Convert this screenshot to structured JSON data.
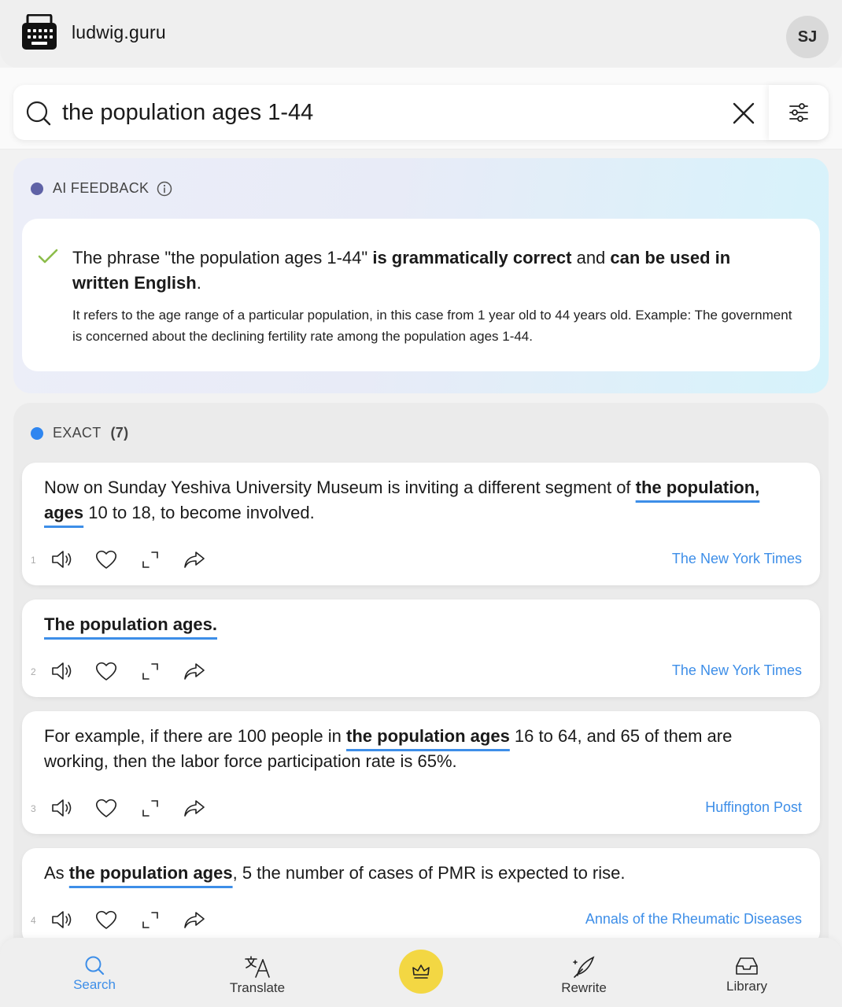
{
  "header": {
    "brand": "ludwig.guru",
    "avatar_initials": "SJ",
    "logo_icon": "typewriter-icon"
  },
  "search": {
    "query": "the population ages 1-44",
    "placeholder": ""
  },
  "ai_feedback": {
    "label": "AI FEEDBACK",
    "main": {
      "intro": "The phrase \"the population ages 1-44\" ",
      "bold1": "is grammatically correct",
      "mid": " and ",
      "bold2": "can be used in written English",
      "end": "."
    },
    "detail": "It refers to the age range of a particular population, in this case from 1 year old to 44 years old. Example: The government is concerned about the declining fertility rate among the population ages 1-44."
  },
  "exact": {
    "label": "EXACT",
    "count": "(7)",
    "results": [
      {
        "rank": "1",
        "before": "Now on Sunday Yeshiva University Museum is inviting a different segment of ",
        "highlight": "the population, ages",
        "after": " 10 to 18, to become involved.",
        "source": "The New York Times"
      },
      {
        "rank": "2",
        "before": "",
        "highlight": "The population ages.",
        "after": "",
        "source": "The New York Times"
      },
      {
        "rank": "3",
        "before": "For example, if there are 100 people in ",
        "highlight": "the population ages",
        "after": " 16 to 64, and 65 of them are working, then the labor force participation rate is 65%.",
        "source": "Huffington Post"
      },
      {
        "rank": "4",
        "before": "As ",
        "highlight": "the population ages",
        "after": ", 5 the number of cases of PMR is expected to rise.",
        "source": "Annals of the Rheumatic Diseases"
      }
    ]
  },
  "nav": {
    "items": [
      {
        "label": "Search",
        "icon": "search-icon",
        "active": true
      },
      {
        "label": "Translate",
        "icon": "translate-icon"
      },
      {
        "label": "Rewrite",
        "icon": "rewrite-icon"
      },
      {
        "label": "Library",
        "icon": "library-icon"
      }
    ],
    "premium_icon": "crown-icon"
  },
  "colors": {
    "accent": "#3d8ee8",
    "ai_dot": "#5f62a6",
    "exact_dot": "#2f86f0",
    "premium": "#f3d743",
    "check": "#8cbd4a"
  }
}
